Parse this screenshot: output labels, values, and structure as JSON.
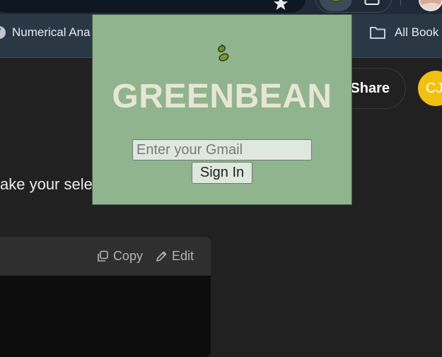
{
  "browser": {
    "bookmarks": [
      {
        "label": "Numerical Ana",
        "icon": "site-icon"
      },
      {
        "label": "All Book",
        "icon": "folder-icon"
      }
    ]
  },
  "page": {
    "share_label": "Share",
    "avatar_initials": "CJ",
    "chat_text": "ake your sele",
    "code_block": {
      "copy_label": "Copy",
      "edit_label": "Edit"
    }
  },
  "popup": {
    "title": "GREENBEAN",
    "logo_icon": "bean-icon",
    "email_placeholder": "Enter your Gmail",
    "email_value": "",
    "sign_in_label": "Sign In",
    "colors": {
      "background": "#90b48e",
      "title": "#e7e6d4"
    }
  }
}
